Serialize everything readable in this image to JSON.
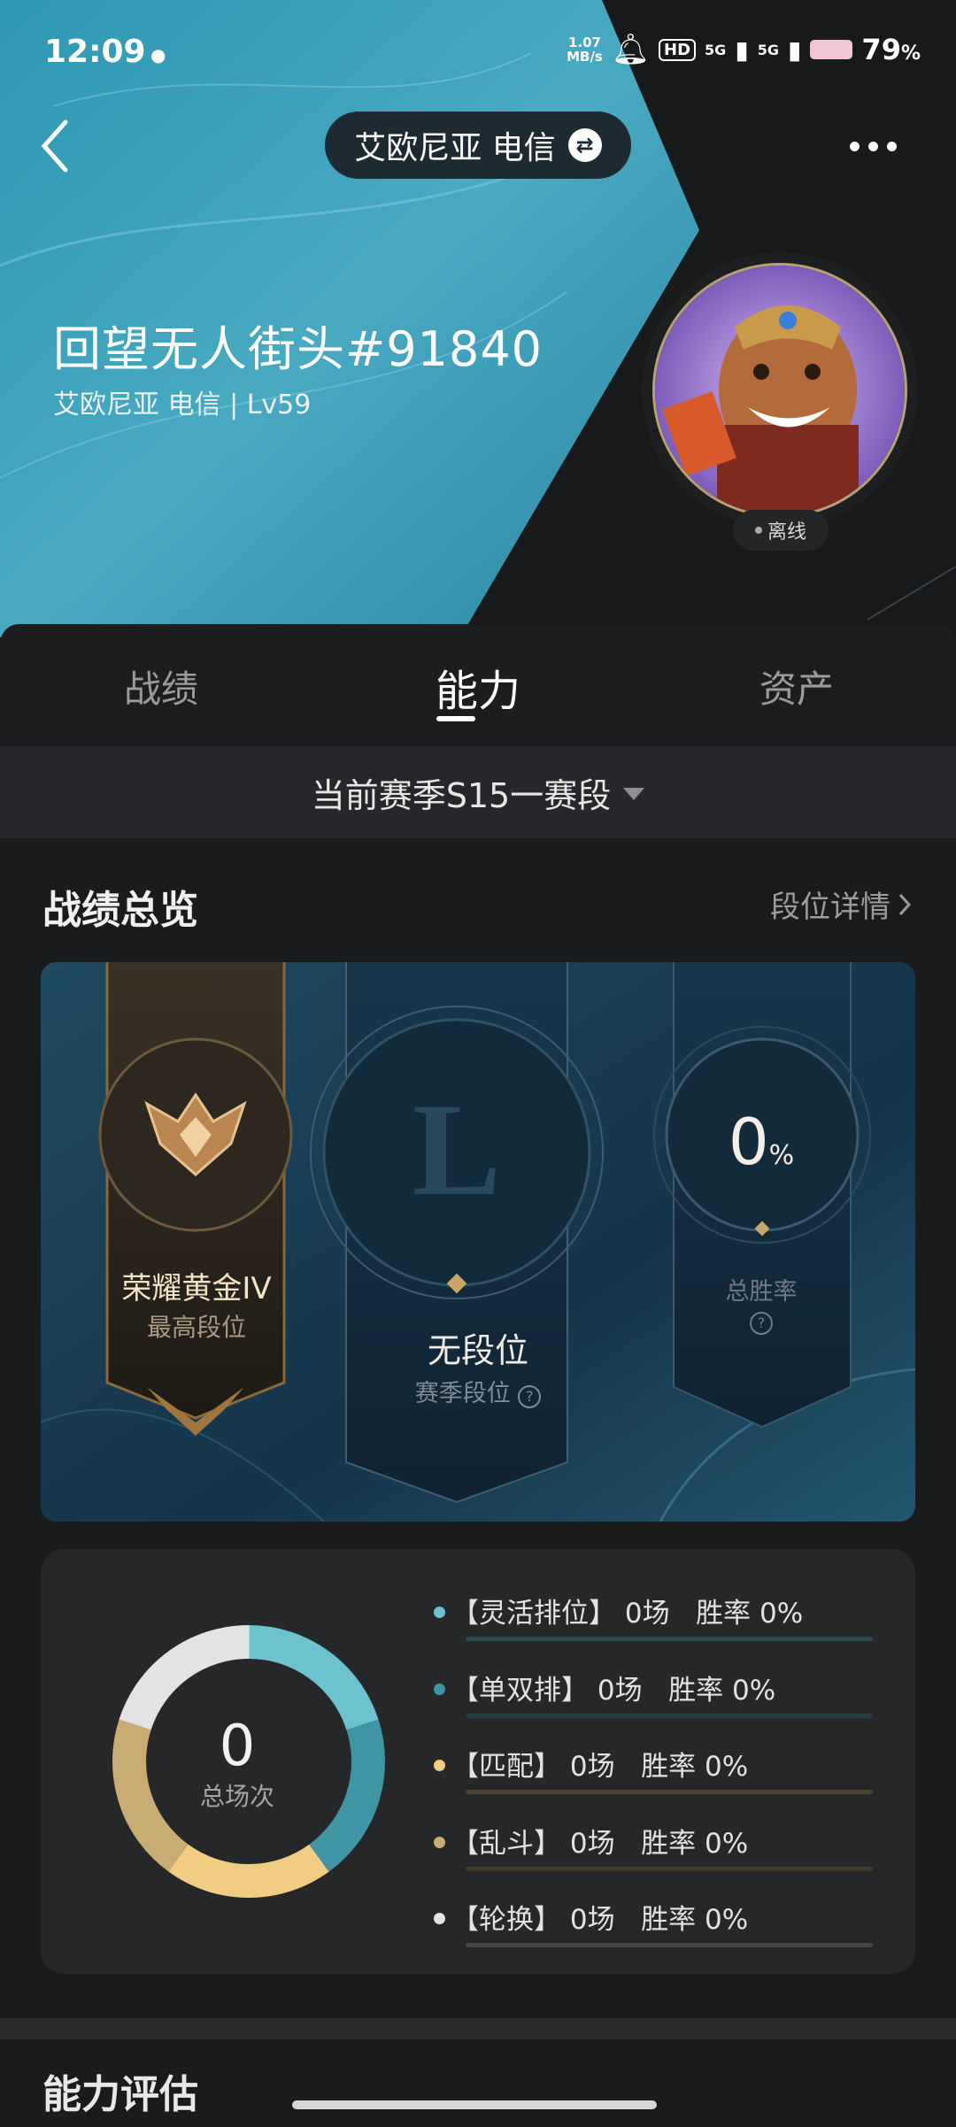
{
  "status_bar": {
    "time": "12:09",
    "speed_value": "1.07",
    "speed_unit": "MB/s",
    "hd_badge": "HD",
    "net1": "5G",
    "net2": "5G",
    "battery": "79",
    "battery_unit": "%"
  },
  "header": {
    "server": "艾欧尼亚 电信",
    "swap_icon": "swap-icon",
    "player_name": "回望无人街头#91840",
    "player_sub": "艾欧尼亚 电信 | Lv59",
    "status": "离线"
  },
  "tabs": [
    {
      "label": "战绩",
      "active": false
    },
    {
      "label": "能力",
      "active": true
    },
    {
      "label": "资产",
      "active": false
    }
  ],
  "season_selector": "当前赛季S15一赛段",
  "overview": {
    "title": "战绩总览",
    "link": "段位详情"
  },
  "ranks": {
    "best_rank": "荣耀黄金IV",
    "best_rank_label": "最高段位",
    "season_rank": "无段位",
    "season_rank_label": "赛季段位",
    "season_emblem_letter": "L",
    "win_rate_value": "0",
    "win_rate_unit": "%",
    "win_rate_label": "总胜率"
  },
  "matches": {
    "total": "0",
    "total_label": "总场次",
    "items": [
      {
        "text": "【灵活排位】 0场   胜率 0%",
        "color": "#6cc3cf"
      },
      {
        "text": "【单双排】 0场   胜率 0%",
        "color": "#3f95a3"
      },
      {
        "text": "【匹配】 0场   胜率 0%",
        "color": "#f0cd83"
      },
      {
        "text": "【乱斗】 0场   胜率 0%",
        "color": "#c8ac74"
      },
      {
        "text": "【轮换】 0场   胜率 0%",
        "color": "#e3e3e3"
      }
    ]
  },
  "next_section_title": "能力评估"
}
